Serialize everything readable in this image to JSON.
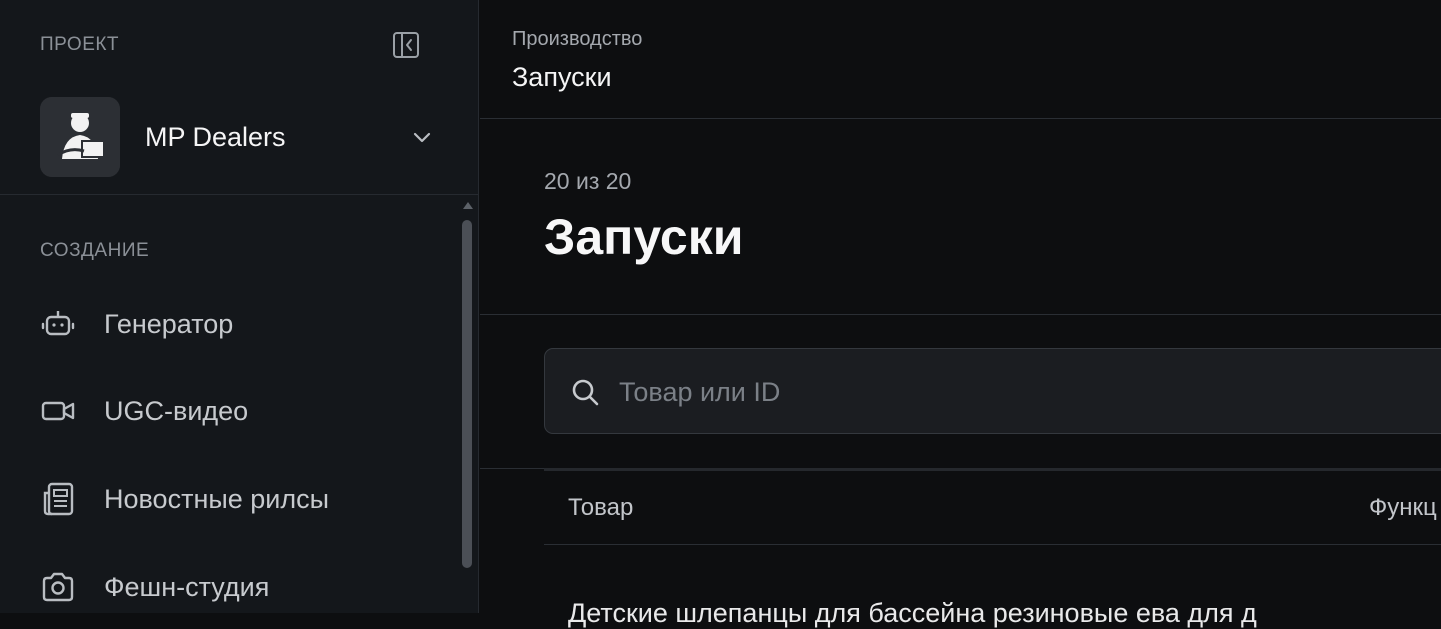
{
  "sidebar": {
    "project_label": "ПРОЕКТ",
    "project_name": "MP Dealers",
    "section_label": "СОЗДАНИЕ",
    "items": [
      {
        "label": "Генератор",
        "icon": "robot-icon"
      },
      {
        "label": "UGC-видео",
        "icon": "video-camera-icon"
      },
      {
        "label": "Новостные рилсы",
        "icon": "newspaper-icon"
      },
      {
        "label": "Фешн-студия",
        "icon": "camera-icon"
      }
    ]
  },
  "header": {
    "breadcrumb_parent": "Производство",
    "breadcrumb_current": "Запуски"
  },
  "main": {
    "count": "20 из 20",
    "title": "Запуски",
    "search": {
      "placeholder": "Товар или ID",
      "value": ""
    },
    "table": {
      "columns": [
        "Товар",
        "Функц"
      ],
      "first_row_partial": "Детские шлепанцы для бассейна резиновые ева для д"
    }
  },
  "colors": {
    "sidebar_bg": "#14171b",
    "main_bg": "#0d0e10",
    "text_primary": "#f5f5f6",
    "text_muted": "#8b9097"
  }
}
